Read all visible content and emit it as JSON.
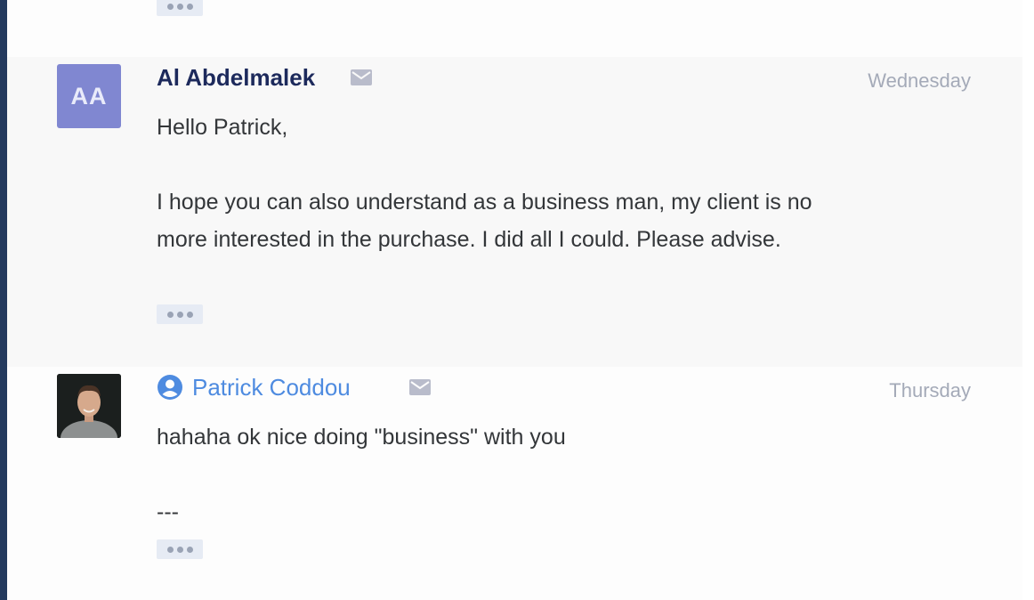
{
  "thread": {
    "messages": [
      {
        "sender": "Al Abdelmalek",
        "avatar_initials": "AA",
        "date": "Wednesday",
        "greeting": "Hello Patrick,",
        "line1": "I hope you can also understand as a business man, my client is no",
        "line2": "more interested in the purchase. I did all I could. Please advise."
      },
      {
        "sender": "Patrick Coddou",
        "date": "Thursday",
        "line1": "hahaha ok nice doing \"business\" with you",
        "line2": "---"
      }
    ]
  },
  "icons": {
    "mail": "mail-icon",
    "user": "user-circle-icon",
    "more": "ellipsis-icon"
  },
  "colors": {
    "rail": "#243a5e",
    "initials_avatar": "#8087d1",
    "sender_bold": "#1d2a5c",
    "sender_link": "#4e8be0",
    "date": "#a4aab8"
  }
}
